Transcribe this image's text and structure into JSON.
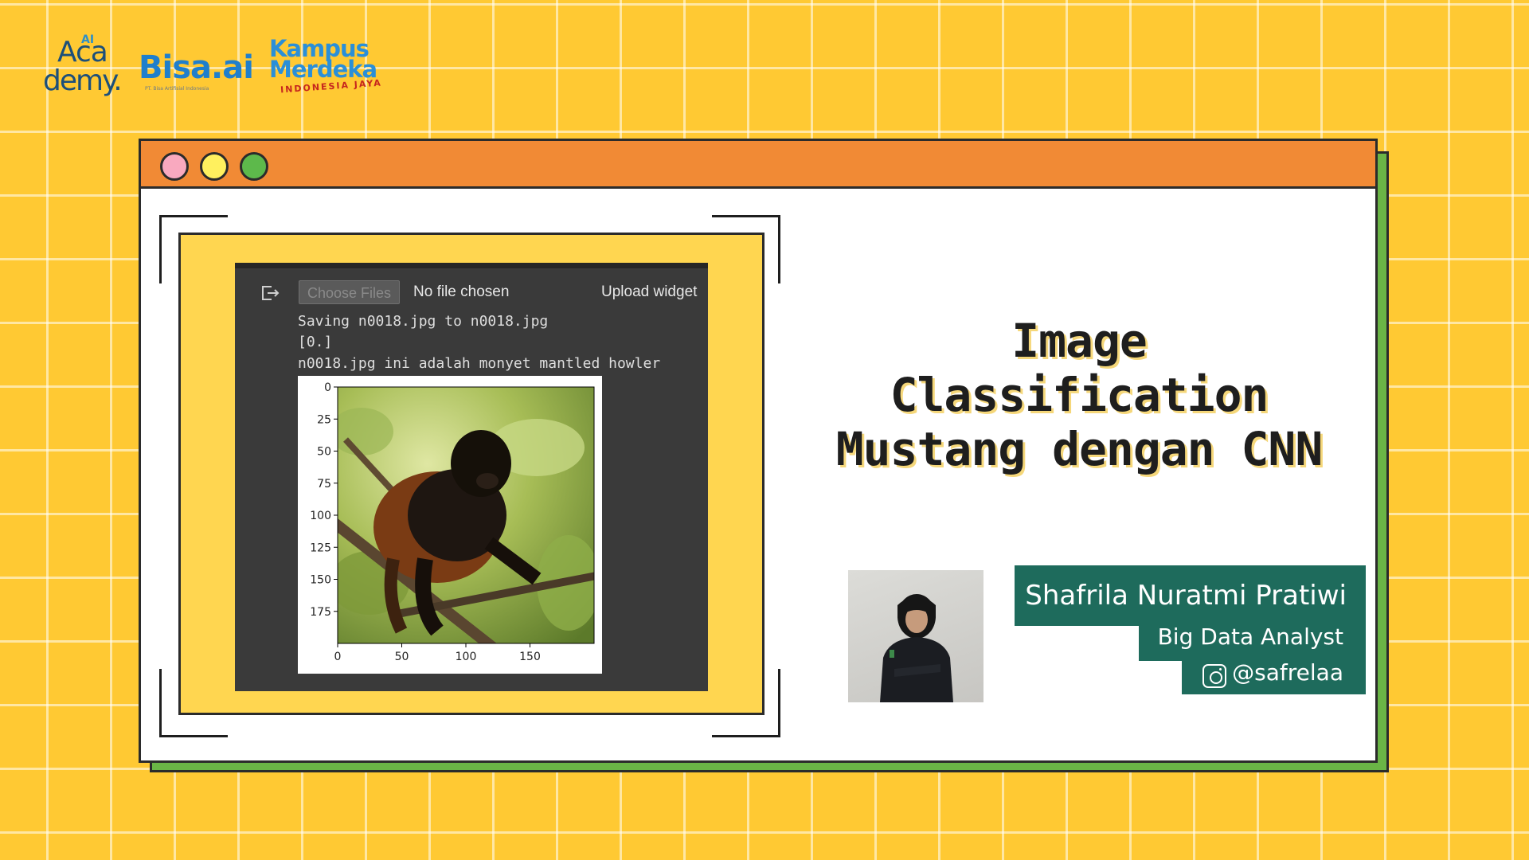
{
  "logos": {
    "academy": {
      "mark": "AI",
      "line1": "Aca",
      "line2": "demy."
    },
    "bisa": {
      "name": "Bisa.ai",
      "sub": "PT. Bisa Artifisial Indonesia"
    },
    "kampus_merdeka": {
      "line1": "Kampus",
      "line2": "Merdeka",
      "line3": "INDONESIA JAYA"
    }
  },
  "window": {
    "controls": [
      "close-dot",
      "minimize-dot",
      "maximize-dot"
    ],
    "colors": {
      "titlebar": "#f18a35",
      "shadow": "#6ab546",
      "frame": "#ffd650"
    }
  },
  "notebook": {
    "choose_button": "Choose Files",
    "file_status": "No file chosen",
    "upload_label": "Upload widget",
    "lines": [
      "Saving n0018.jpg to n0018.jpg",
      "[0.]",
      "n0018.jpg ini adalah monyet mantled howler"
    ]
  },
  "chart_data": {
    "type": "image",
    "x_ticks": [
      "0",
      "50",
      "100",
      "150"
    ],
    "y_ticks": [
      "0",
      "25",
      "50",
      "75",
      "100",
      "125",
      "150",
      "175"
    ],
    "xlim": [
      0,
      200
    ],
    "ylim": [
      200,
      0
    ]
  },
  "slide": {
    "title_lines": [
      "Image",
      "Classification",
      "Mustang dengan CNN"
    ]
  },
  "presenter": {
    "name": "Shafrila Nuratmi Pratiwi",
    "role": "Big Data Analyst",
    "instagram": "@safrelaa",
    "accent": "#1e6b5c"
  }
}
